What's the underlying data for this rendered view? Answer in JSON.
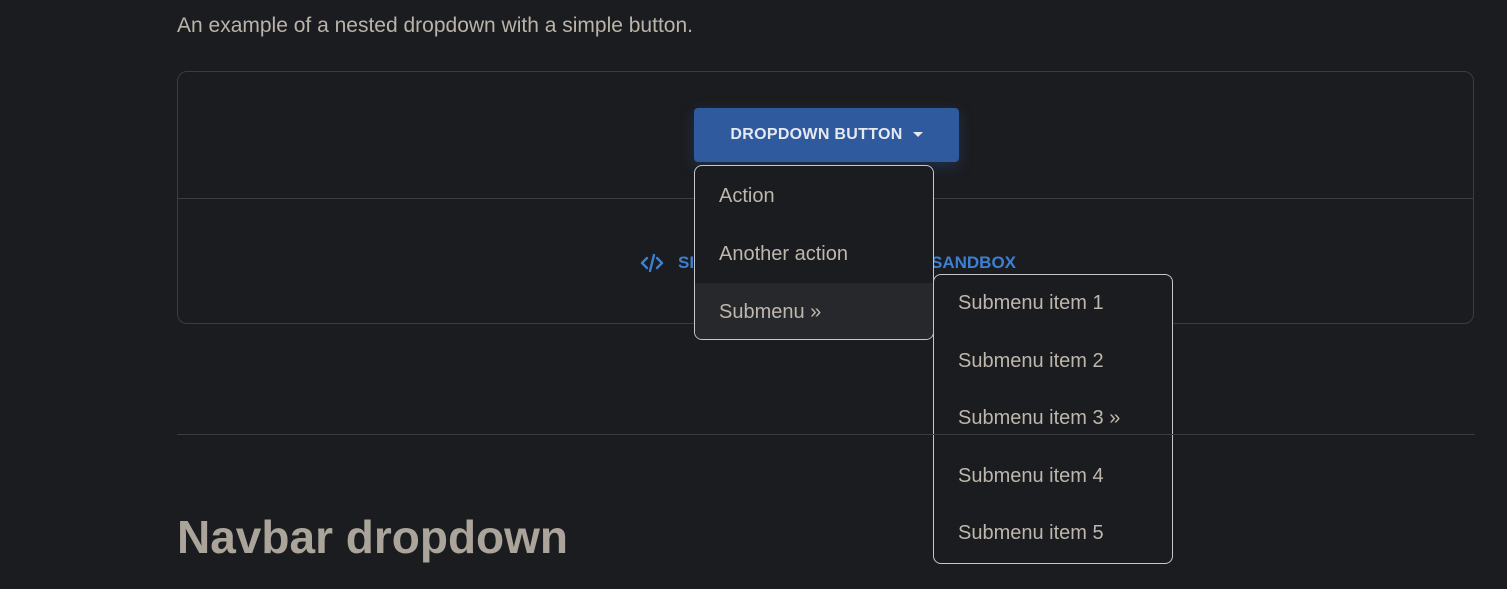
{
  "intro_text": "An example of a nested dropdown with a simple button.",
  "dropdown_button": {
    "label": "DROPDOWN BUTTON"
  },
  "example_links": {
    "code_label_partial": "SI",
    "sandbox_label_partial": "SANDBOX"
  },
  "main_menu": {
    "items": [
      "Action",
      "Another action",
      "Submenu »"
    ]
  },
  "submenu": {
    "items": [
      "Submenu item 1",
      "Submenu item 2",
      "Submenu item 3 »",
      "Submenu item 4",
      "Submenu item 5"
    ]
  },
  "section_heading": "Navbar dropdown",
  "colors": {
    "background": "#1b1c1f",
    "button": "#2f5a9e",
    "link": "#3d7fd1",
    "menu_border": "#c7c7c7"
  }
}
